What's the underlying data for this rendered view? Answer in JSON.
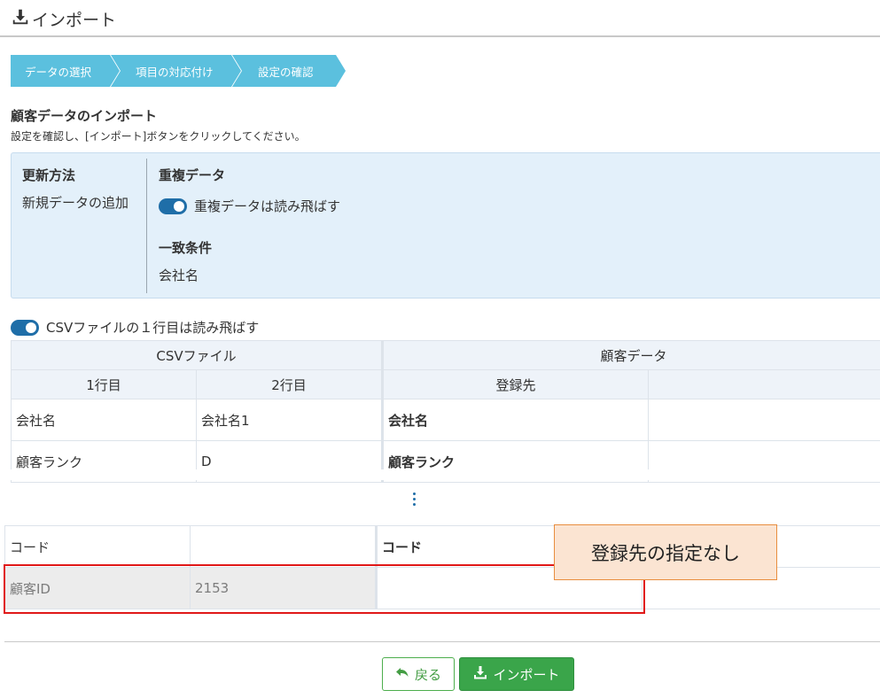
{
  "header": {
    "title": "インポート",
    "icon": "download-icon"
  },
  "steps": [
    "データの選択",
    "項目の対応付け",
    "設定の確認"
  ],
  "section": {
    "title": "顧客データのインポート",
    "description": "設定を確認し、[インポート]ボタンをクリックしてください。"
  },
  "settings": {
    "update_method_label": "更新方法",
    "update_method_value": "新規データの追加",
    "duplicate_label": "重複データ",
    "duplicate_toggle_label": "重複データは読み飛ばす",
    "match_label": "一致条件",
    "match_value": "会社名"
  },
  "skip_first_row_label": "CSVファイルの１行目は読み飛ばす",
  "grid": {
    "group_csv": "CSVファイル",
    "group_target": "顧客データ",
    "col_row1": "1行目",
    "col_row2": "2行目",
    "col_dest": "登録先",
    "rows": [
      {
        "row1": "会社名",
        "row2": "会社名1",
        "dest": "会社名"
      },
      {
        "row1": "顧客ランク",
        "row2": "D",
        "dest": "顧客ランク"
      }
    ]
  },
  "grid2": {
    "rows": [
      {
        "row1": "コード",
        "row2": "",
        "dest": "コード"
      },
      {
        "row1": "顧客ID",
        "row2": "2153",
        "dest": ""
      }
    ]
  },
  "callout": "登録先の指定なし",
  "buttons": {
    "back": "戻る",
    "import": "インポート"
  },
  "colors": {
    "step": "#5bc0de",
    "toggle": "#1f6ea8",
    "highlight": "#e01818",
    "callout_bg": "#fbe4d2",
    "import_btn": "#3aa54a"
  }
}
